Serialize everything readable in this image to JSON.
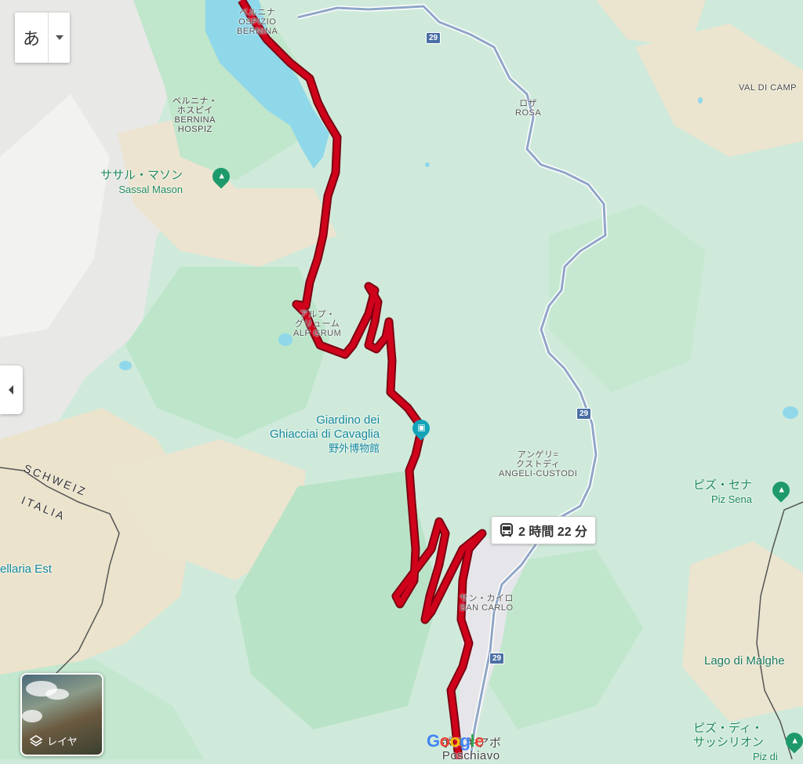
{
  "ime_toggle": {
    "char": "あ"
  },
  "duration_badge": {
    "text": "2 時間 22 分",
    "icon": "bus-icon"
  },
  "layers_button": {
    "label": "レイヤ",
    "icon": "layers-icon"
  },
  "logo": {
    "text": "Google"
  },
  "route": {
    "color": "#d0021b"
  },
  "labels": {
    "ospizio_jp": "ベルニナ",
    "ospizio": "OSPIZIO",
    "bernina": "BERNINA",
    "hospiz_jp1": "ベルニナ・",
    "hospiz_jp2": "ホスピイ",
    "hospiz1": "BERNINA",
    "hospiz2": "HOSPIZ",
    "sassal_jp": "ササル・マソン",
    "sassal": "Sassal Mason",
    "rosa_jp": "ロザ",
    "rosa": "ROSA",
    "val_di_campo": "VAL DI CAMP",
    "alp_grum_jp1": "アルプ・",
    "alp_grum_jp2": "グリューム",
    "alp_grum": "ALP GRUM",
    "giardino1": "Giardino dei",
    "giardino2": "Ghiacciai di Cavaglia",
    "giardino_jp": "野外博物館",
    "angeli_jp1": "アンゲリ=",
    "angeli_jp2": "クストディ",
    "angeli": "ANGELI-CUSTODI",
    "piz_sena_jp": "ピズ・セナ",
    "piz_sena": "Piz Sena",
    "schweiz": "SCHWEIZ",
    "italia": "ITALIA",
    "bellaria": "ellaria Est",
    "san_carlo_jp": "サン・カイロ",
    "san_carlo": "SAN CARLO",
    "lago_malghera": "Lago di Malghe",
    "piz_sassiglion_jp1": "ピズ・ディ・",
    "piz_sassiglion_jp2": "サッシリオン",
    "piz_sassiglion": "Piz di",
    "poschiavo_jp": "ポスキアボ",
    "poschiavo": "Poschiavo"
  },
  "road_shields": [
    "29",
    "29",
    "29"
  ],
  "icons": {
    "sassal": "mountain-icon",
    "giardino": "museum-icon",
    "piz_sena": "mountain-icon",
    "piz_sassiglion": "mountain-icon"
  }
}
